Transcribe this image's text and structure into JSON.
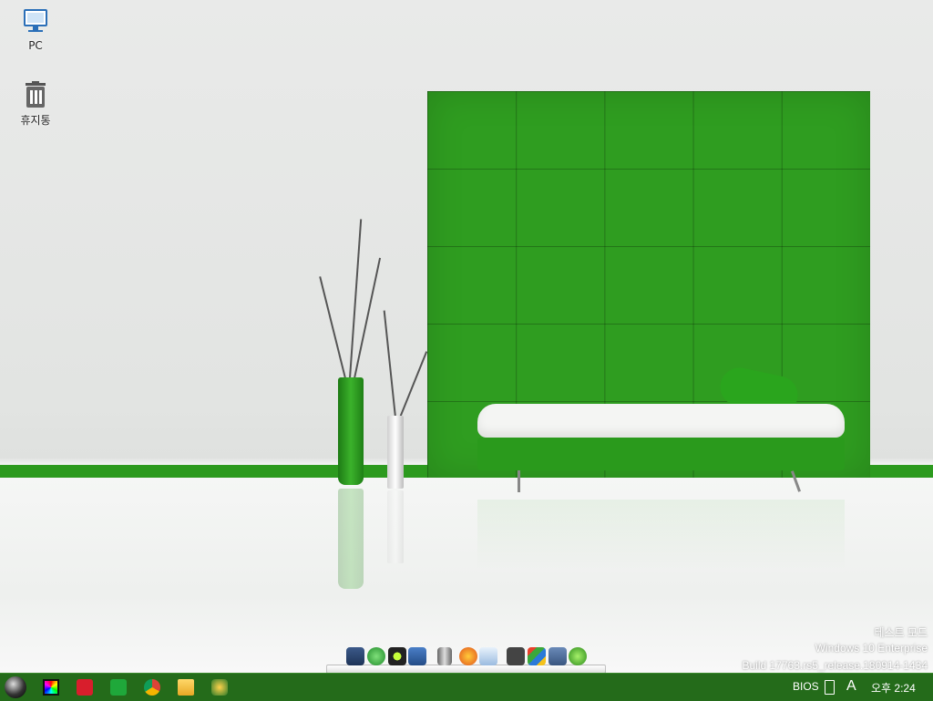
{
  "desktop": {
    "icons": [
      {
        "label": "PC",
        "icon": "computer-icon"
      },
      {
        "label": "휴지통",
        "icon": "recycle-bin-icon"
      }
    ]
  },
  "watermark": {
    "mode": "테스트 모드",
    "edition": "Windows 10 Enterprise",
    "build": "Build 17763.rs5_release.180914-1434"
  },
  "dock": {
    "items": [
      "screen-icon",
      "refresh-icon",
      "green-circle-icon",
      "network-icon",
      "usb-drive-icon",
      "firefox-icon",
      "notepad-icon",
      "7zip-icon",
      "control-panel-icon",
      "disk-icon",
      "globe-icon"
    ]
  },
  "taskbar": {
    "start_icon": "start-orb-icon",
    "pinned": [
      "color-picker-icon",
      "power-icon",
      "green-app-icon",
      "chrome-icon",
      "folder-icon",
      "tool-icon"
    ],
    "tray": {
      "bios_label": "BIOS",
      "ime_label": "A",
      "clock": "오후 2:24"
    }
  },
  "colors": {
    "taskbar": "#246b1a",
    "accent_green": "#2f9d20"
  }
}
